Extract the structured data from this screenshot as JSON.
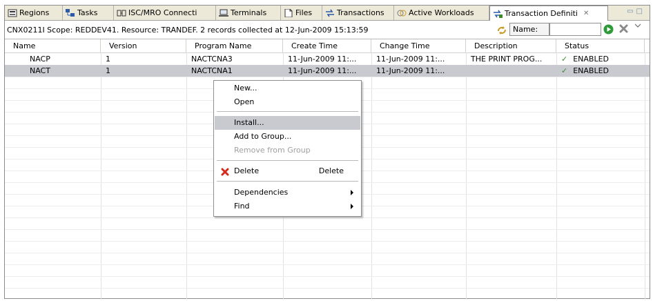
{
  "tabs": [
    {
      "label": "Regions",
      "icon": "regions-icon"
    },
    {
      "label": "Tasks",
      "icon": "tasks-icon"
    },
    {
      "label": "ISC/MRO Connecti",
      "icon": "connection-icon"
    },
    {
      "label": "Terminals",
      "icon": "terminal-icon"
    },
    {
      "label": "Files",
      "icon": "file-icon"
    },
    {
      "label": "Transactions",
      "icon": "transactions-icon"
    },
    {
      "label": "Active Workloads",
      "icon": "workload-icon"
    },
    {
      "label": "Transaction Definiti",
      "icon": "transaction-definition-icon",
      "close": "✕"
    }
  ],
  "info": {
    "message": "CNX0211I Scope: REDDEV41. Resource: TRANDEF. 2 records collected at 12-Jun-2009 15:13:59",
    "name_label": "Name:",
    "name_value": ""
  },
  "table": {
    "columns": [
      "Name",
      "Version",
      "Program Name",
      "Create Time",
      "Change Time",
      "Description",
      "Status"
    ],
    "rows": [
      {
        "name": "NACP",
        "version": "1",
        "program": "NACTCNA3",
        "create": "11-Jun-2009 11:...",
        "change": "11-Jun-2009 11:...",
        "description": "THE PRINT PROG...",
        "status": "ENABLED"
      },
      {
        "name": "NACT",
        "version": "1",
        "program": "NACTCNA1",
        "create": "11-Jun-2009 11:...",
        "change": "11-Jun-2009 11:...",
        "description": "",
        "status": "ENABLED"
      }
    ]
  },
  "context_menu": {
    "new": "New...",
    "open": "Open",
    "install": "Install...",
    "add_to_group": "Add to Group...",
    "remove_from_group": "Remove from Group",
    "delete": "Delete",
    "delete_accel": "Delete",
    "dependencies": "Dependencies",
    "find": "Find"
  },
  "colors": {
    "selection": "#c9cad0",
    "status_check": "#3a8a2a",
    "delete_icon": "#d42a1a",
    "go_button": "#2e9a3a"
  }
}
